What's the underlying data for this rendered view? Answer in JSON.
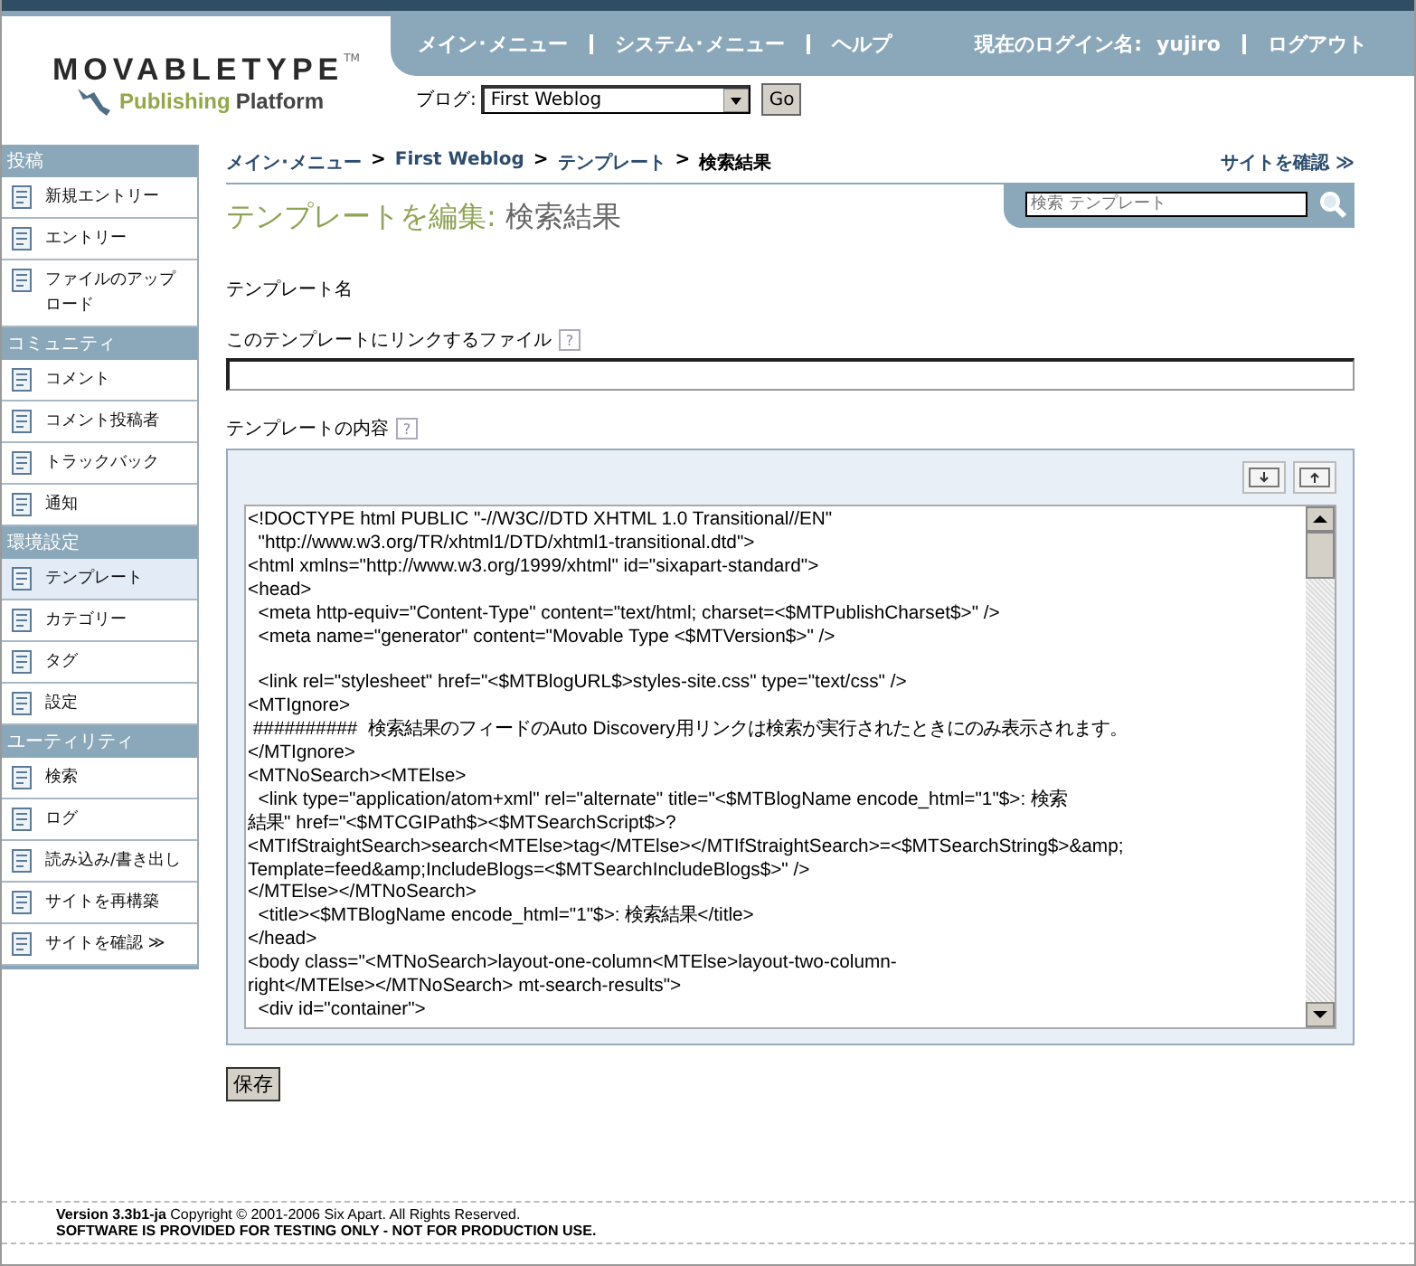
{
  "header": {
    "logo_word_1": "MOVABLETYPE",
    "logo_tm": "TM",
    "logo_word_2": "Publishing",
    "logo_word_3": "Platform",
    "nav": [
      "メイン･メニュー",
      "システム･メニュー",
      "ヘルプ"
    ],
    "login_label": "現在のログイン名:",
    "login_user": "yujiro",
    "logout": "ログアウト",
    "blog_label": "ブログ:",
    "blog_value": "First Weblog",
    "go": "Go"
  },
  "sidebar": [
    {
      "title": "投稿",
      "items": [
        {
          "label": "新規エントリー",
          "selected": false
        },
        {
          "label": "エントリー",
          "selected": false
        },
        {
          "label": "ファイルのアップロード",
          "selected": false
        }
      ]
    },
    {
      "title": "コミュニティ",
      "items": [
        {
          "label": "コメント",
          "selected": false
        },
        {
          "label": "コメント投稿者",
          "selected": false
        },
        {
          "label": "トラックバック",
          "selected": false
        },
        {
          "label": "通知",
          "selected": false
        }
      ]
    },
    {
      "title": "環境設定",
      "items": [
        {
          "label": "テンプレート",
          "selected": true
        },
        {
          "label": "カテゴリー",
          "selected": false
        },
        {
          "label": "タグ",
          "selected": false
        },
        {
          "label": "設定",
          "selected": false
        }
      ]
    },
    {
      "title": "ユーティリティ",
      "items": [
        {
          "label": "検索",
          "selected": false
        },
        {
          "label": "ログ",
          "selected": false
        },
        {
          "label": "読み込み/書き出し",
          "selected": false
        },
        {
          "label": "サイトを再構築",
          "selected": false
        },
        {
          "label": "サイトを確認 ≫",
          "selected": false
        }
      ]
    }
  ],
  "breadcrumb": [
    "メイン･メニュー",
    "First Weblog",
    "テンプレート"
  ],
  "breadcrumb_current": "検索結果",
  "breadcrumb_separator": ">",
  "view_site": "サイトを確認 ≫",
  "title_prefix": "テンプレートを編集:",
  "title_name": "検索結果",
  "search": {
    "placeholder": "検索 テンプレート"
  },
  "form": {
    "name_label": "テンプレート名",
    "link_label": "このテンプレートにリンクするファイル",
    "help": "?",
    "content_label": "テンプレートの内容",
    "code_blocks": [
      [
        "<!DOCTYPE html PUBLIC \"-//W3C//DTD XHTML 1.0 Transitional//EN\"",
        "  \"http://www.w3.org/TR/xhtml1/DTD/xhtml1-transitional.dtd\">",
        "<html xmlns=\"http://www.w3.org/1999/xhtml\" id=\"sixapart-standard\">",
        "<head>",
        "  <meta http-equiv=\"Content-Type\" content=\"text/html; charset=<$MTPublishCharset$>\" />",
        "  <meta name=\"generator\" content=\"Movable Type <$MTVersion$>\" />"
      ],
      [
        "  <link rel=\"stylesheet\" href=\"<$MTBlogURL$>styles-site.css\" type=\"text/css\" />",
        "<MTIgnore>",
        " ##########  検索結果のフィードのAuto Discovery用リンクは検索が実行されたときにのみ表示されます。",
        "</MTIgnore>",
        "<MTNoSearch><MTElse>",
        "  <link type=\"application/atom+xml\" rel=\"alternate\" title=\"<$MTBlogName encode_html=\"1\"$>: 検索",
        "結果\" href=\"<$MTCGIPath$><$MTSearchScript$>?",
        "<MTIfStraightSearch>search<MTElse>tag</MTElse></MTIfStraightSearch>=<$MTSearchString$>&amp;",
        "Template=feed&amp;IncludeBlogs=<$MTSearchIncludeBlogs$>\" />",
        "</MTElse></MTNoSearch>",
        "  <title><$MTBlogName encode_html=\"1\"$>: 検索結果</title>",
        "</head>",
        "<body class=\"<MTNoSearch>layout-one-column<MTElse>layout-two-column-",
        "right</MTElse></MTNoSearch> mt-search-results\">",
        "  <div id=\"container\">"
      ]
    ]
  },
  "save": "保存",
  "footer": {
    "version": "Version 3.3b1-ja",
    "copyright": "Copyright © 2001-2006 Six Apart. All Rights Reserved.",
    "warning": "SOFTWARE IS PROVIDED FOR TESTING ONLY - NOT FOR PRODUCTION USE."
  }
}
